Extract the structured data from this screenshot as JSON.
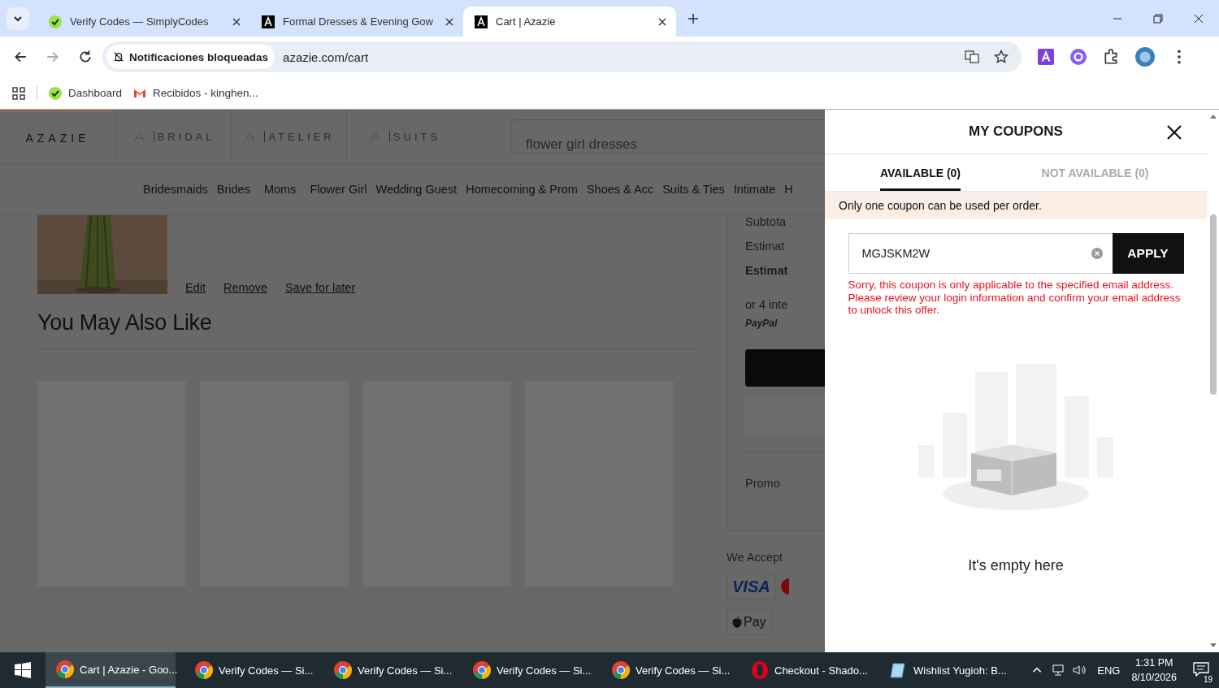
{
  "browser": {
    "tabs": [
      {
        "title": "Verify Codes — SimplyCodes",
        "kind": "simplycodes",
        "selected": false
      },
      {
        "title": "Formal Dresses & Evening Gow",
        "kind": "azazie",
        "selected": false
      },
      {
        "title": "Cart | Azazie",
        "kind": "azazie",
        "selected": true
      }
    ],
    "site_info": "Notificaciones bloqueadas",
    "url": "azazie.com/cart",
    "bookmarks": [
      {
        "label": "Dashboard",
        "kind": "simplycodes"
      },
      {
        "label": "Recibidos - kinghen...",
        "kind": "gmail"
      }
    ]
  },
  "page": {
    "logo": "AZAZIE",
    "brands": [
      "BRIDAL",
      "ATELIER",
      "SUITS"
    ],
    "search_value": "flower girl dresses",
    "nav": [
      "Bridesmaids",
      "Brides",
      "Moms",
      "Flower Girl",
      "Wedding Guest",
      "Homecoming & Prom",
      "Shoes & Acc",
      "Suits & Ties",
      "Intimate",
      "H"
    ],
    "item_actions": [
      "Edit",
      "Remove",
      "Save for later"
    ],
    "section_title": "You May Also Like",
    "summary": [
      {
        "text": "Subtota",
        "bold": false
      },
      {
        "text": "Estimat",
        "bold": false
      },
      {
        "text": "Estimat",
        "bold": true
      },
      {
        "text": "or 4 inte",
        "bold": false
      }
    ],
    "paypal": "PayPal",
    "promo": "Promo",
    "we_accept": "We Accept",
    "visa": "VISA",
    "apple_pay": "Pay"
  },
  "drawer": {
    "title": "MY COUPONS",
    "tabs": [
      {
        "label": "AVAILABLE (0)",
        "selected": true
      },
      {
        "label": "NOT AVAILABLE (0)",
        "selected": false
      }
    ],
    "notice": "Only one coupon can be used per order.",
    "code": "MGJSKM2W",
    "apply": "APPLY",
    "error": "Sorry, this coupon is only applicable to the specified email address. Please review your login information and confirm your email address to unlock this offer.",
    "empty": "It's empty here"
  },
  "taskbar": {
    "items": [
      {
        "label": "Cart | Azazie - Goo...",
        "kind": "chrome",
        "selected": true
      },
      {
        "label": "Verify Codes — Si...",
        "kind": "chrome",
        "selected": false
      },
      {
        "label": "Verify Codes — Si...",
        "kind": "chrome",
        "selected": false
      },
      {
        "label": "Verify Codes — Si...",
        "kind": "chrome",
        "selected": false
      },
      {
        "label": "Verify Codes — Si...",
        "kind": "chrome",
        "selected": false
      },
      {
        "label": "Checkout - Shado...",
        "kind": "opera",
        "selected": false
      },
      {
        "label": "Wishlist Yugioh: B...",
        "kind": "notepad",
        "selected": false
      }
    ],
    "language": "ENG",
    "time": "1:31 PM",
    "date": "8/10/2026",
    "notifications": "19"
  }
}
